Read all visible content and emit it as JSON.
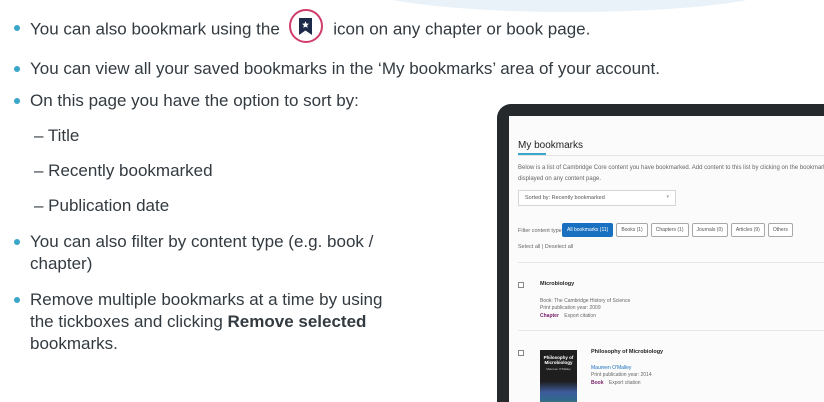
{
  "bullets_top": [
    {
      "before": "You can also bookmark using the",
      "after": "icon on any chapter or book page.",
      "icon": "bookmark-star-icon"
    },
    {
      "text": "You can view all your saved bookmarks in the ‘My bookmarks’ area of your account."
    }
  ],
  "left_col": {
    "sort_intro": "On this page you have the option to sort by:",
    "sort_options": [
      "– Title",
      "– Recently bookmarked",
      "– Publication date"
    ],
    "filter_text": "You can also filter by content type (e.g. book / chapter)",
    "remove_before": "Remove multiple bookmarks at a time by using the tickboxes and clicking",
    "remove_bold": "Remove selected",
    "remove_after": "bookmarks."
  },
  "screen": {
    "title": "My bookmarks",
    "description": "Below is a list of Cambridge Core content you have bookmarked. Add content to this list by clicking on the bookmark icon displayed on any content page.",
    "sort_value": "Sorted by: Recently bookmarked",
    "filter_label": "Filter content type:",
    "chips": [
      "All bookmarks (11)",
      "Books (1)",
      "Chapters (1)",
      "Journals (0)",
      "Articles (9)",
      "Others"
    ],
    "select_links": "Select all | Deselect all",
    "items": [
      {
        "title": "Microbiology",
        "line1": "Book: The Cambridge History of Science",
        "line2": "Print publication year: 2009",
        "type": "Chapter",
        "action": "Export citation"
      },
      {
        "title": "Philosophy of Microbiology",
        "author": "Maureen O'Malley",
        "line2": "Print publication year: 2014",
        "type": "Book",
        "action": "Export citation",
        "cover_title": "Philosophy of Microbiology",
        "cover_author": "Maureen O'Malley"
      }
    ]
  },
  "colors": {
    "bullet": "#3aa6c9",
    "icon_ring": "#d03d6b",
    "active_chip": "#1a70c0",
    "content_type": "#7a1f6a"
  }
}
